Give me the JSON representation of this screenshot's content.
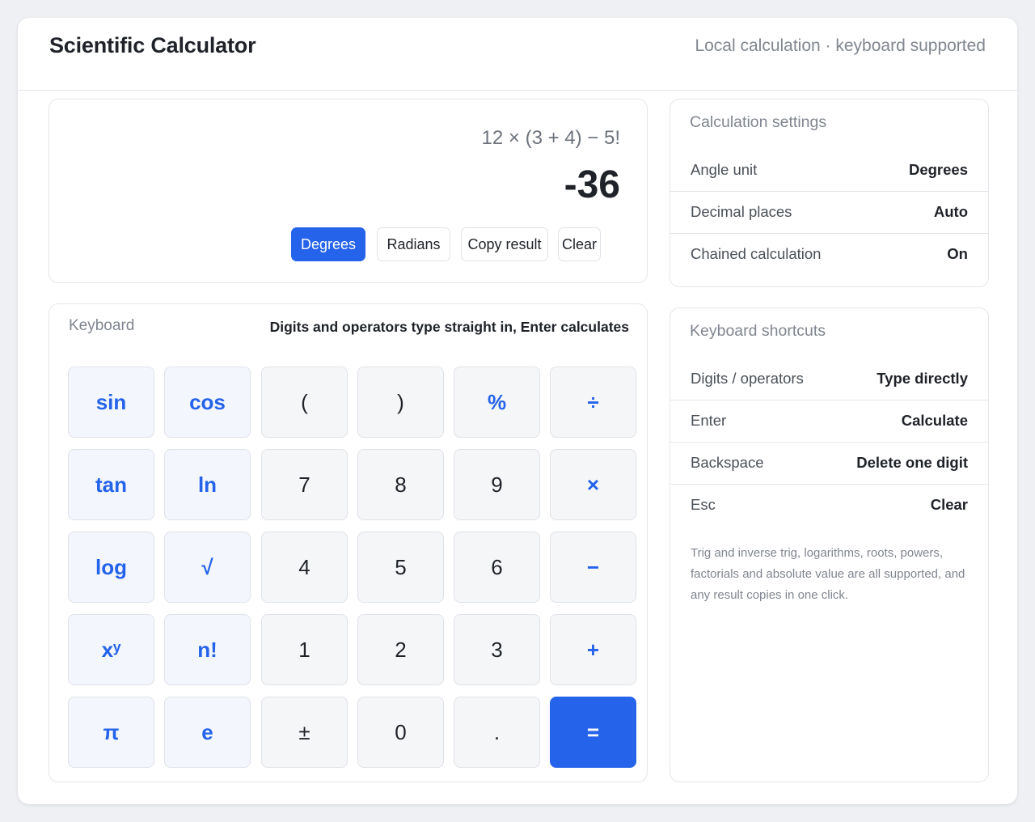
{
  "header": {
    "title": "Scientific Calculator",
    "subtitle": "Local calculation · keyboard supported"
  },
  "display": {
    "expression": "12 × (3 + 4) − 5!",
    "result": "-36",
    "buttons": {
      "degrees": "Degrees",
      "radians": "Radians",
      "copy": "Copy result",
      "clear": "Clear"
    },
    "active_angle_unit": "Degrees"
  },
  "keyboard": {
    "title": "Keyboard",
    "hint": "Digits and operators type straight in, Enter calculates",
    "keys": [
      [
        "sin",
        "cos",
        "(",
        ")",
        "%",
        "÷"
      ],
      [
        "tan",
        "ln",
        "7",
        "8",
        "9",
        "×"
      ],
      [
        "log",
        "√",
        "4",
        "5",
        "6",
        "−"
      ],
      [
        "xʸ",
        "n!",
        "1",
        "2",
        "3",
        "+"
      ],
      [
        "π",
        "e",
        "±",
        "0",
        ".",
        "="
      ]
    ]
  },
  "settings": {
    "title": "Calculation settings",
    "rows": [
      {
        "label": "Angle unit",
        "value": "Degrees"
      },
      {
        "label": "Decimal places",
        "value": "Auto"
      },
      {
        "label": "Chained calculation",
        "value": "On"
      }
    ]
  },
  "shortcuts": {
    "title": "Keyboard shortcuts",
    "rows": [
      {
        "label": "Digits / operators",
        "value": "Type directly"
      },
      {
        "label": "Enter",
        "value": "Calculate"
      },
      {
        "label": "Backspace",
        "value": "Delete one digit"
      },
      {
        "label": "Esc",
        "value": "Clear"
      }
    ],
    "note": "Trig and inverse trig, logarithms, roots, powers, factorials and absolute value are all supported, and any result copies in one click."
  },
  "colors": {
    "accent": "#2563eb",
    "background": "#eef0f3",
    "key_bg": "#f5f6f8",
    "function_key_bg": "#f3f6fd"
  }
}
